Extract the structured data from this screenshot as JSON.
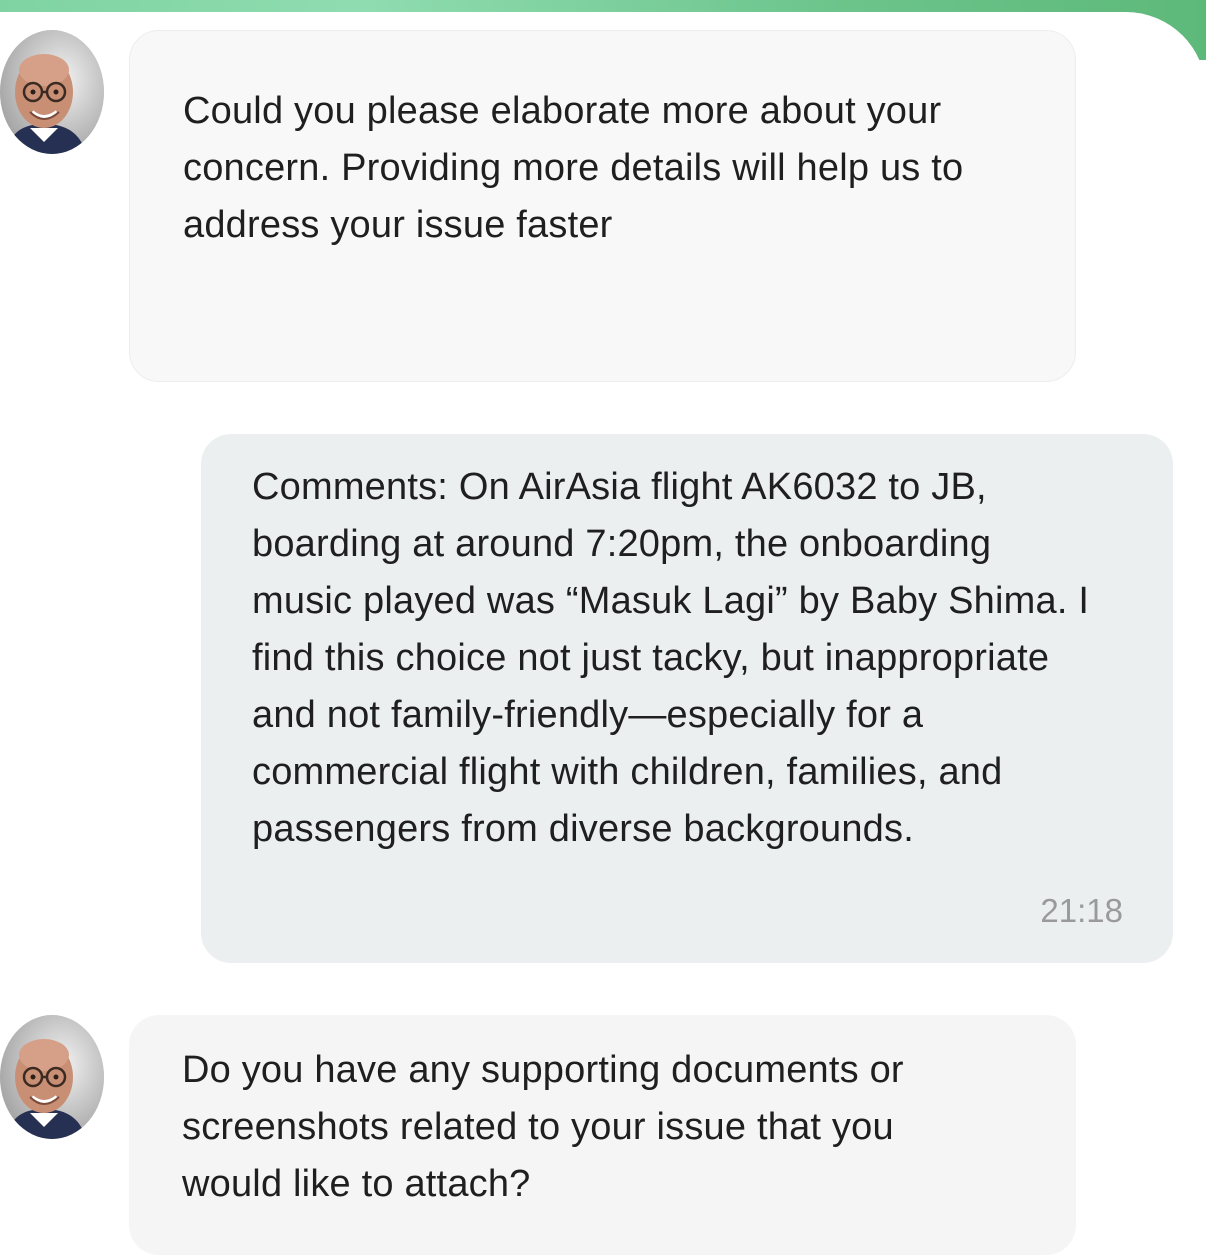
{
  "agent": {
    "avatar_icon": "agent-avatar-icon"
  },
  "messages": [
    {
      "sender": "agent",
      "lines": [
        "Could you please elaborate more about your",
        "concern. Providing more details will help us to",
        "address your issue faster"
      ]
    },
    {
      "sender": "user",
      "lines": [
        "Comments: On AirAsia flight AK6032 to JB,",
        "boarding at around 7:20pm, the onboarding",
        "music played was “Masuk Lagi” by Baby Shima. I",
        "find this choice not just tacky, but inappropriate",
        "and not family-friendly—especially for a",
        "commercial flight with children, families, and",
        "passengers from diverse backgrounds."
      ],
      "time": "21:18"
    },
    {
      "sender": "agent",
      "lines": [
        "Do you have any supporting documents or",
        "screenshots related to your issue that you",
        "would like to attach?"
      ]
    }
  ],
  "colors": {
    "header_accent": "#6cc48b",
    "agent_bubble": "#f8f8f8",
    "user_bubble": "#eceff0",
    "timestamp": "#9a9a9a"
  }
}
